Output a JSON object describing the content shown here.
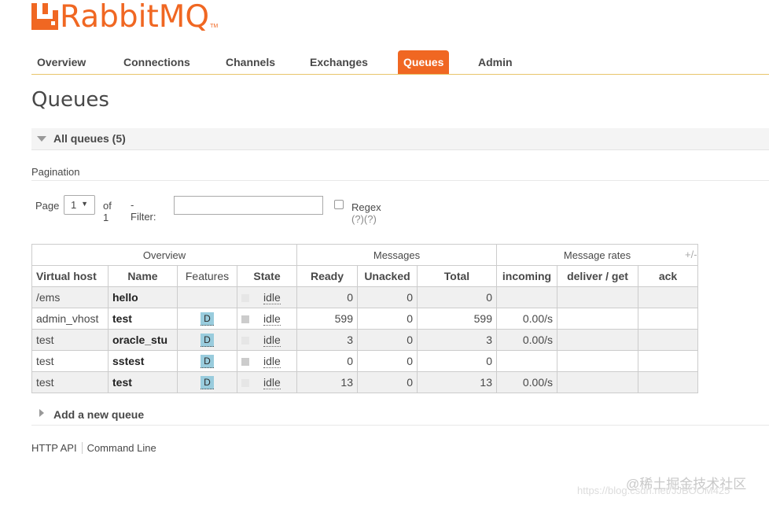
{
  "brand": {
    "name": "RabbitMQ",
    "tm": "TM",
    "color": "#f06722"
  },
  "nav": {
    "items": [
      {
        "label": "Overview",
        "active": false
      },
      {
        "label": "Connections",
        "active": false
      },
      {
        "label": "Channels",
        "active": false
      },
      {
        "label": "Exchanges",
        "active": false
      },
      {
        "label": "Queues",
        "active": true
      },
      {
        "label": "Admin",
        "active": false
      }
    ]
  },
  "page": {
    "title": "Queues"
  },
  "section": {
    "label": "All queues (5)"
  },
  "pagination": {
    "label": "Pagination",
    "page_label": "Page",
    "page_value": "1",
    "of_label": "of 1",
    "filter_label": "- Filter:",
    "filter_value": "",
    "regex_label": "Regex",
    "regex_help": "(?)(?)"
  },
  "table": {
    "groups": [
      "Overview",
      "Messages",
      "Message rates"
    ],
    "columns": [
      "Virtual host",
      "Name",
      "Features",
      "State",
      "Ready",
      "Unacked",
      "Total",
      "incoming",
      "deliver / get",
      "ack"
    ],
    "plus_minus": "+/-",
    "rows": [
      {
        "vhost": "/ems",
        "name": "hello",
        "feature": "",
        "state": "idle",
        "ready": "0",
        "unacked": "0",
        "total": "0",
        "incoming": "",
        "deliver": "",
        "ack": ""
      },
      {
        "vhost": "admin_vhost",
        "name": "test",
        "feature": "D",
        "state": "idle",
        "ready": "599",
        "unacked": "0",
        "total": "599",
        "incoming": "0.00/s",
        "deliver": "",
        "ack": ""
      },
      {
        "vhost": "test",
        "name": "oracle_stu",
        "feature": "D",
        "state": "idle",
        "ready": "3",
        "unacked": "0",
        "total": "3",
        "incoming": "0.00/s",
        "deliver": "",
        "ack": ""
      },
      {
        "vhost": "test",
        "name": "sstest",
        "feature": "D",
        "state": "idle",
        "ready": "0",
        "unacked": "0",
        "total": "0",
        "incoming": "",
        "deliver": "",
        "ack": ""
      },
      {
        "vhost": "test",
        "name": "test",
        "feature": "D",
        "state": "idle",
        "ready": "13",
        "unacked": "0",
        "total": "13",
        "incoming": "0.00/s",
        "deliver": "",
        "ack": ""
      }
    ]
  },
  "add_queue": {
    "label": "Add a new queue"
  },
  "footer": {
    "links": [
      "HTTP API",
      "Command Line"
    ]
  },
  "watermark": {
    "line1": "@稀土掘金技术社区",
    "line2": "https://blog.csdn.net/JJBOOM425"
  }
}
